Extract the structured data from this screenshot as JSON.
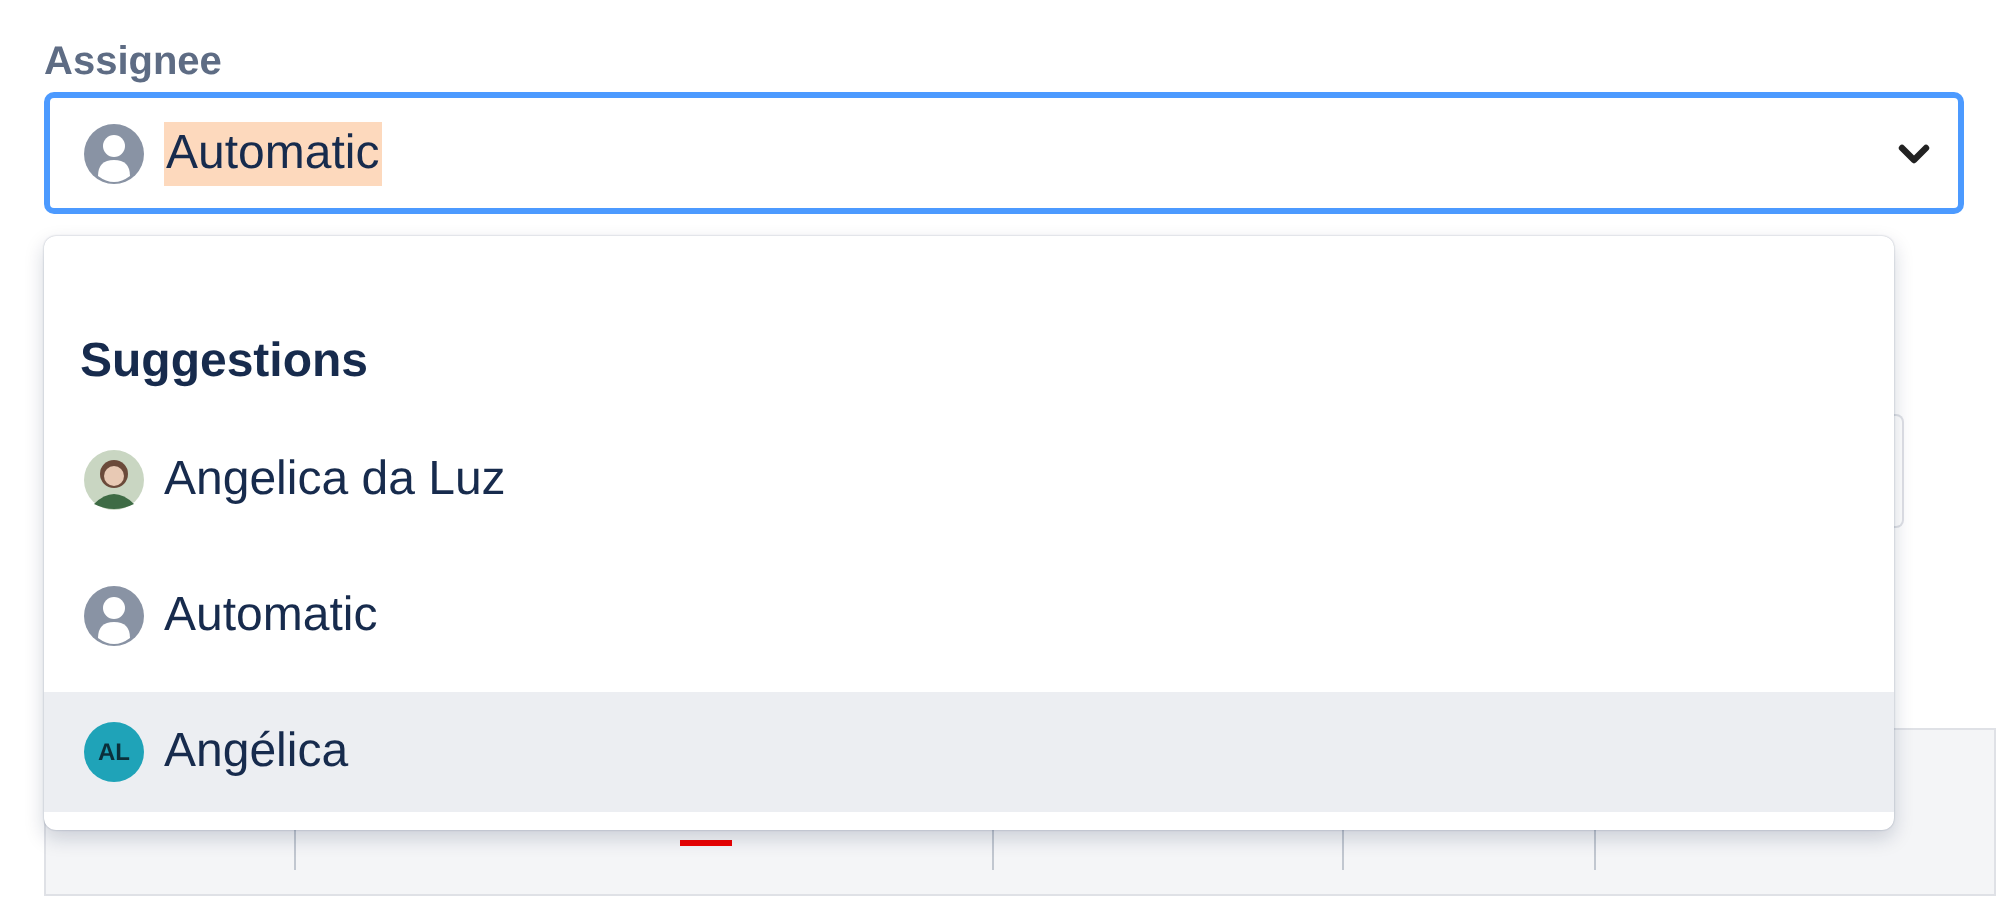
{
  "field": {
    "label": "Assignee",
    "value": "Automatic",
    "value_selected": true,
    "kind": "default"
  },
  "suggestions": {
    "title": "Suggestions",
    "items": [
      {
        "name": "Angelica da Luz",
        "kind": "photo",
        "selected": false
      },
      {
        "name": "Automatic",
        "kind": "default",
        "selected": false
      },
      {
        "name": "Angélica",
        "kind": "initials",
        "initials": "AL",
        "color": "#1fa3b8",
        "selected": true
      }
    ]
  }
}
